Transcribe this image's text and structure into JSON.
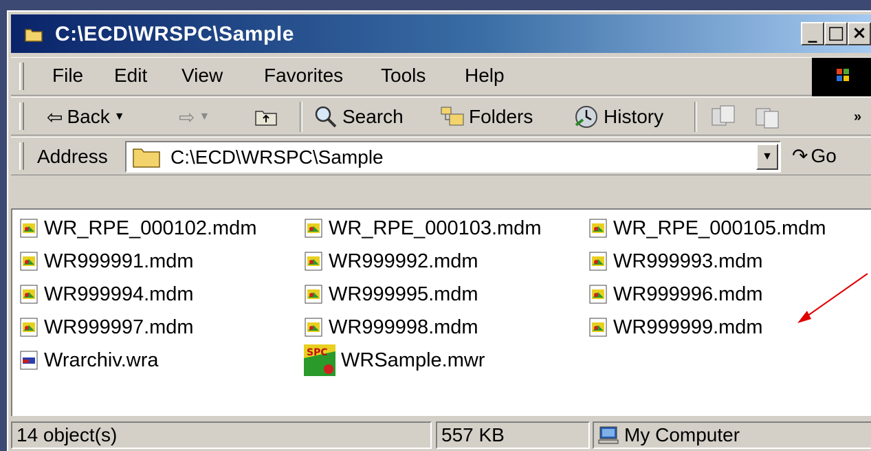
{
  "window": {
    "title": "C:\\ECD\\WRSPC\\Sample",
    "buttons": {
      "minimize": "_",
      "maximize": "□",
      "close": "×"
    }
  },
  "menu": [
    {
      "label": "File"
    },
    {
      "label": "Edit"
    },
    {
      "label": "View"
    },
    {
      "label": "Favorites"
    },
    {
      "label": "Tools"
    },
    {
      "label": "Help"
    }
  ],
  "toolbar": {
    "back": "Back",
    "search": "Search",
    "folders": "Folders",
    "history": "History",
    "more": "»"
  },
  "address": {
    "label": "Address",
    "value": "C:\\ECD\\WRSPC\\Sample",
    "go": "Go"
  },
  "files": [
    {
      "name": "WR_RPE_000102.mdm",
      "icon": "mdm-file-icon"
    },
    {
      "name": "WR_RPE_000103.mdm",
      "icon": "mdm-file-icon"
    },
    {
      "name": "WR_RPE_000105.mdm",
      "icon": "mdm-file-icon"
    },
    {
      "name": "WR999991.mdm",
      "icon": "mdm-file-icon"
    },
    {
      "name": "WR999992.mdm",
      "icon": "mdm-file-icon"
    },
    {
      "name": "WR999993.mdm",
      "icon": "mdm-file-icon"
    },
    {
      "name": "WR999994.mdm",
      "icon": "mdm-file-icon"
    },
    {
      "name": "WR999995.mdm",
      "icon": "mdm-file-icon"
    },
    {
      "name": "WR999996.mdm",
      "icon": "mdm-file-icon"
    },
    {
      "name": "WR999997.mdm",
      "icon": "mdm-file-icon"
    },
    {
      "name": "WR999998.mdm",
      "icon": "mdm-file-icon"
    },
    {
      "name": "WR999999.mdm",
      "icon": "mdm-file-icon"
    },
    {
      "name": "Wrarchiv.wra",
      "icon": "wra-file-icon"
    },
    {
      "name": "WRSample.mwr",
      "icon": "spc-file-icon"
    }
  ],
  "status": {
    "objects": "14 object(s)",
    "size": "557 KB",
    "zone": "My Computer"
  },
  "colors": {
    "titlebar_start": "#0a246a",
    "titlebar_end": "#a6caf0",
    "annotation_arrow": "#e00000",
    "chrome": "#d4d0c8"
  }
}
